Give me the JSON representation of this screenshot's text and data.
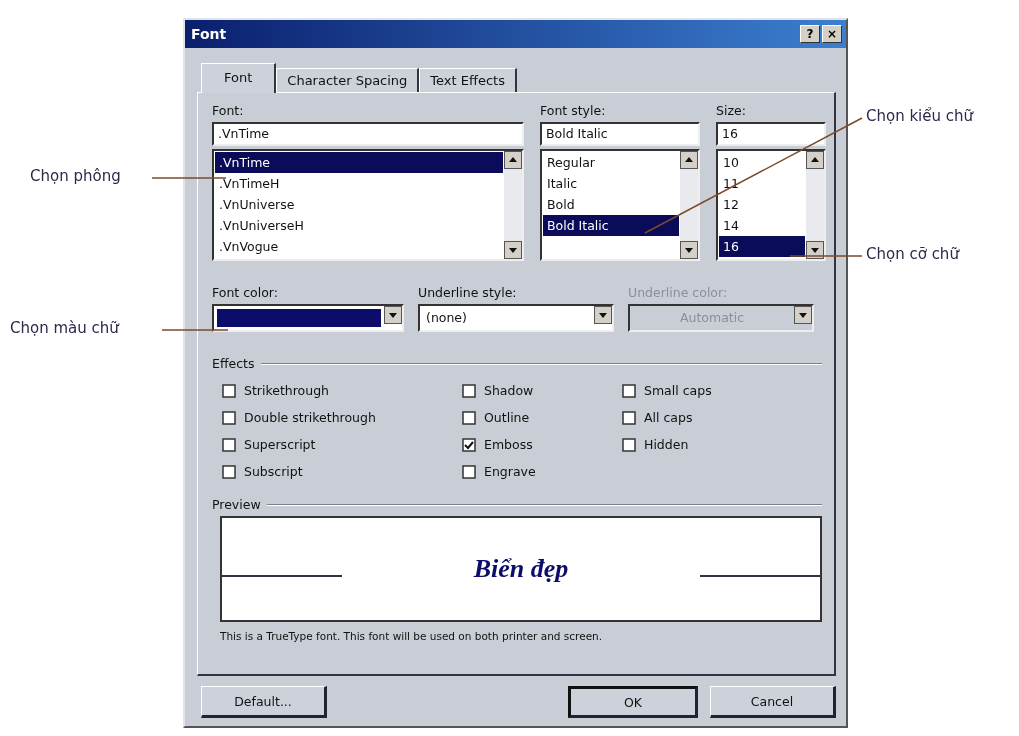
{
  "window": {
    "title": "Font",
    "help": "?",
    "close": "×"
  },
  "tabs": [
    {
      "label": "Font",
      "selected": true
    },
    {
      "label": "Character Spacing",
      "selected": false
    },
    {
      "label": "Text Effects",
      "selected": false
    }
  ],
  "font": {
    "label": "Font:",
    "value": ".VnTime",
    "items": [
      {
        "label": ".VnTime",
        "selected": true
      },
      {
        "label": ".VnTimeH",
        "selected": false
      },
      {
        "label": ".VnUniverse",
        "selected": false
      },
      {
        "label": ".VnUniverseH",
        "selected": false
      },
      {
        "label": ".VnVogue",
        "selected": false
      }
    ]
  },
  "font_style": {
    "label": "Font style:",
    "value": "Bold Italic",
    "items": [
      {
        "label": "Regular",
        "selected": false
      },
      {
        "label": "Italic",
        "selected": false
      },
      {
        "label": "Bold",
        "selected": false
      },
      {
        "label": "Bold Italic",
        "selected": true
      }
    ]
  },
  "size": {
    "label": "Size:",
    "value": "16",
    "items": [
      {
        "label": "10",
        "selected": false
      },
      {
        "label": "11",
        "selected": false
      },
      {
        "label": "12",
        "selected": false
      },
      {
        "label": "14",
        "selected": false
      },
      {
        "label": "16",
        "selected": true
      }
    ]
  },
  "font_color": {
    "label": "Font color:",
    "color": "#0c0c6a"
  },
  "underline_style": {
    "label": "Underline style:",
    "value": "(none)",
    "disabled": false
  },
  "underline_color": {
    "label": "Underline color:",
    "value": "Automatic",
    "disabled": true
  },
  "effects": {
    "title": "Effects",
    "options": [
      {
        "label": "Strikethrough",
        "checked": false
      },
      {
        "label": "Double strikethrough",
        "checked": false
      },
      {
        "label": "Superscript",
        "checked": false
      },
      {
        "label": "Subscript",
        "checked": false
      },
      {
        "label": "Shadow",
        "checked": false
      },
      {
        "label": "Outline",
        "checked": false
      },
      {
        "label": "Emboss",
        "checked": true
      },
      {
        "label": "Engrave",
        "checked": false
      },
      {
        "label": "Small caps",
        "checked": false
      },
      {
        "label": "All caps",
        "checked": false
      },
      {
        "label": "Hidden",
        "checked": false
      }
    ]
  },
  "preview": {
    "title": "Preview",
    "sample": "Biển đẹp",
    "note": "This is a TrueType font. This font will be used on both printer and screen."
  },
  "buttons": [
    {
      "label": "Default...",
      "default": false
    },
    {
      "label": "OK",
      "default": true
    },
    {
      "label": "Cancel",
      "default": false
    }
  ],
  "annotations": [
    {
      "text": "Chọn phông"
    },
    {
      "text": "Chọn kiểu chữ"
    },
    {
      "text": "Chọn cỡ chữ"
    },
    {
      "text": "Chọn màu chữ"
    }
  ]
}
